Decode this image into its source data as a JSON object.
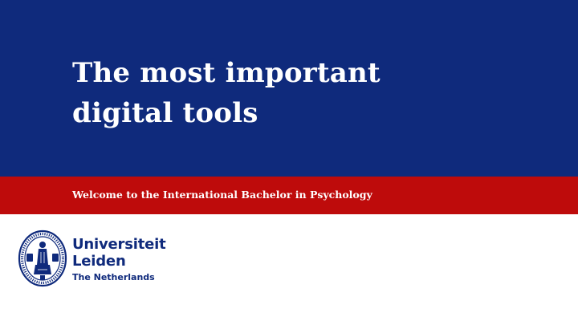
{
  "slide": {
    "title_line1": "The most important",
    "title_line2": "digital tools",
    "subtitle": "Welcome to the International Bachelor in Psychology"
  },
  "logo": {
    "name_line1": "Universiteit",
    "name_line2": "Leiden",
    "country": "The Netherlands",
    "seal_icon": "university-seal-icon"
  },
  "colors": {
    "title_band": "#0f2a7c",
    "subtitle_band": "#be0b0b",
    "text_on_band": "#ffffff",
    "logo": "#0f2a7c"
  }
}
